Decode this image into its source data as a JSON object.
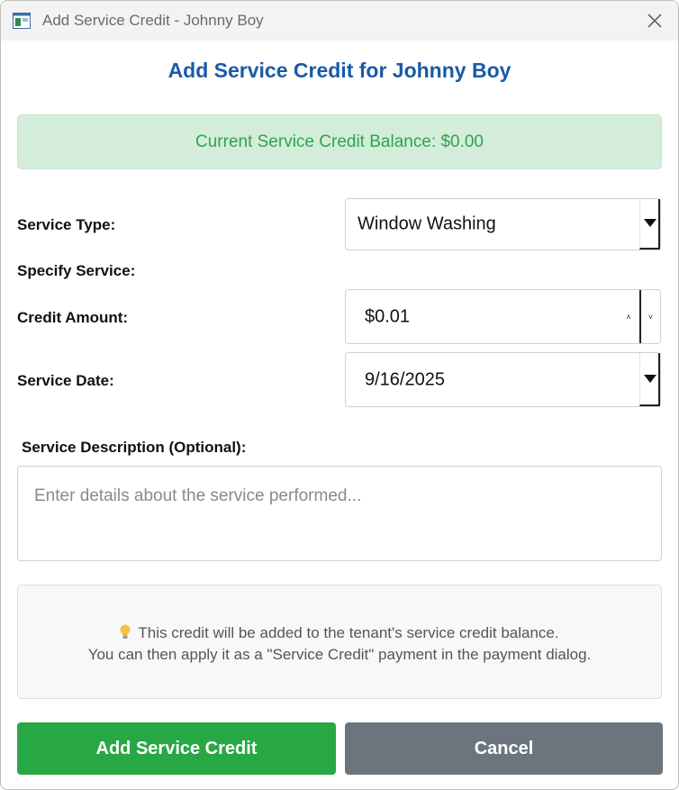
{
  "window": {
    "title": "Add Service Credit - Johnny Boy",
    "close_icon": "close-icon",
    "app_icon": "app-window-icon"
  },
  "heading": "Add Service Credit for Johnny Boy",
  "balance": {
    "text": "Current Service Credit Balance: $0.00"
  },
  "form": {
    "service_type": {
      "label": "Service Type:",
      "value": "Window Washing"
    },
    "specify_service": {
      "label": "Specify Service:"
    },
    "credit_amount": {
      "label": "Credit Amount:",
      "value": "$0.01",
      "spin_up": "˄",
      "spin_down": "˅"
    },
    "service_date": {
      "label": "Service Date:",
      "value": "9/16/2025"
    },
    "description": {
      "label": "Service Description (Optional):",
      "placeholder": "Enter details about the service performed..."
    }
  },
  "info": {
    "icon": "lightbulb-icon",
    "line1": "This credit will be added to the tenant's service credit balance.",
    "line2": "You can then apply it as a \"Service Credit\" payment in the payment dialog."
  },
  "buttons": {
    "add": "Add Service Credit",
    "cancel": "Cancel"
  },
  "colors": {
    "heading": "#1a5aa6",
    "balance_bg": "#d4edda",
    "balance_text": "#2ea44f",
    "primary_button": "#28a745",
    "cancel_button": "#6c757d"
  }
}
